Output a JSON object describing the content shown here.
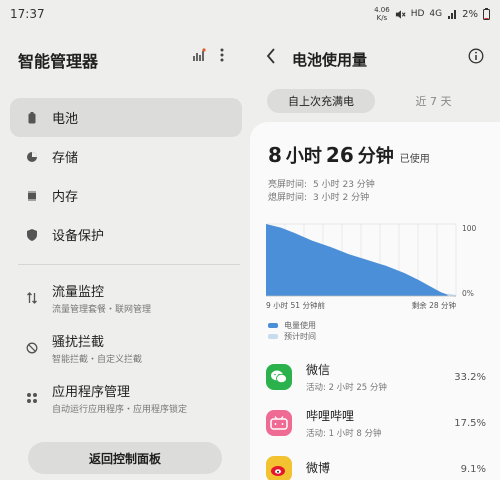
{
  "status": {
    "time": "17:37",
    "speed_top": "4.06",
    "speed_bottom": "K/s",
    "network": "4G",
    "hd": "HD",
    "battery": "2%"
  },
  "left": {
    "title": "智能管理器",
    "nav": [
      {
        "label": "电池",
        "icon": "battery-icon"
      },
      {
        "label": "存储",
        "icon": "storage-icon"
      },
      {
        "label": "内存",
        "icon": "memory-icon"
      },
      {
        "label": "设备保护",
        "icon": "shield-icon"
      }
    ],
    "tools": [
      {
        "title": "流量监控",
        "subtitle": "流量管理套餐・联网管理",
        "icon": "data-usage-icon"
      },
      {
        "title": "骚扰拦截",
        "subtitle": "智能拦截・自定义拦截",
        "icon": "block-icon"
      },
      {
        "title": "应用程序管理",
        "subtitle": "自动运行应用程序・应用程序锁定",
        "icon": "apps-icon"
      }
    ],
    "back_button": "返回控制面板"
  },
  "right": {
    "title": "电池使用量",
    "tabs": {
      "active": "自上次充满电",
      "inactive": "近 7 天"
    },
    "usage": {
      "hours": "8",
      "hours_unit": "小时",
      "minutes": "26",
      "minutes_unit": "分钟",
      "suffix": "已使用"
    },
    "screen_on_label": "亮屏时间:",
    "screen_on_value": "5 小时 23 分钟",
    "screen_off_label": "熄屏时间:",
    "screen_off_value": "3 小时 2 分钟",
    "axis_left": "9 小时 51 分钟前",
    "axis_right": "剩余 28 分钟",
    "y_top": "100",
    "y_bottom": "0%",
    "legend_used": "电量使用",
    "legend_forecast": "预计时间",
    "apps": [
      {
        "name": "微信",
        "detail": "活动: 2 小时 25 分钟",
        "percent": "33.2%",
        "icon": "wechat-icon"
      },
      {
        "name": "哔哩哔哩",
        "detail": "活动: 1 小时 8 分钟",
        "percent": "17.5%",
        "icon": "bilibili-icon"
      },
      {
        "name": "微博",
        "detail": "",
        "percent": "9.1%",
        "icon": "weibo-icon"
      }
    ]
  },
  "chart_data": {
    "type": "area",
    "x": [
      0,
      0.8,
      1.5,
      2.5,
      3.5,
      4.5,
      5.5,
      6.5,
      7.5,
      8.3,
      9.0,
      9.5,
      9.85,
      10.3
    ],
    "values": [
      100,
      95,
      88,
      77,
      68,
      58,
      50,
      42,
      32,
      22,
      12,
      5,
      2,
      0
    ],
    "forecast_x": [
      9.85,
      10.3
    ],
    "ylim": [
      0,
      100
    ],
    "colors": {
      "used": "#4a8fd8",
      "forecast": "#c8dcef"
    }
  }
}
